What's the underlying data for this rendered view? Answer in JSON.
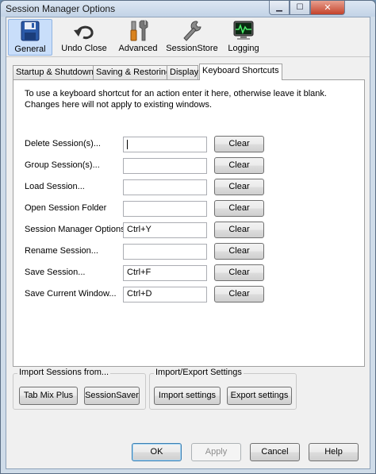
{
  "window": {
    "title": "Session Manager Options"
  },
  "panes": [
    {
      "label": "General",
      "icon": "floppy-disk-icon",
      "selected": true
    },
    {
      "label": "Undo Close",
      "icon": "undo-arrow-icon"
    },
    {
      "label": "Advanced",
      "icon": "tools-icon"
    },
    {
      "label": "SessionStore",
      "icon": "wrench-icon"
    },
    {
      "label": "Logging",
      "icon": "monitor-log-icon"
    }
  ],
  "tabs": [
    {
      "label": "Startup & Shutdown"
    },
    {
      "label": "Saving & Restoring"
    },
    {
      "label": "Display"
    },
    {
      "label": "Keyboard Shortcuts",
      "active": true
    }
  ],
  "shortcuts": {
    "intro": "To use a keyboard shortcut for an action enter it here, otherwise leave it blank. Changes here will not apply to existing windows.",
    "clear_label": "Clear",
    "rows": [
      {
        "label": "Delete Session(s)...",
        "value": ""
      },
      {
        "label": "Group Session(s)...",
        "value": ""
      },
      {
        "label": "Load Session...",
        "value": ""
      },
      {
        "label": "Open Session Folder",
        "value": ""
      },
      {
        "label": "Session Manager Options",
        "value": "Ctrl+Y"
      },
      {
        "label": "Rename Session...",
        "value": ""
      },
      {
        "label": "Save Session...",
        "value": "Ctrl+F"
      },
      {
        "label": "Save Current Window...",
        "value": "Ctrl+D"
      }
    ]
  },
  "import_sessions": {
    "title": "Import Sessions from...",
    "tab_mix_plus": "Tab Mix Plus",
    "session_saver": "SessionSaver"
  },
  "import_export": {
    "title": "Import/Export Settings",
    "import": "Import settings",
    "export": "Export settings"
  },
  "footer": {
    "ok": "OK",
    "apply": "Apply",
    "cancel": "Cancel",
    "help": "Help"
  },
  "colors": {
    "selected_pane": "#c9defa",
    "close_button": "#c4432b"
  }
}
